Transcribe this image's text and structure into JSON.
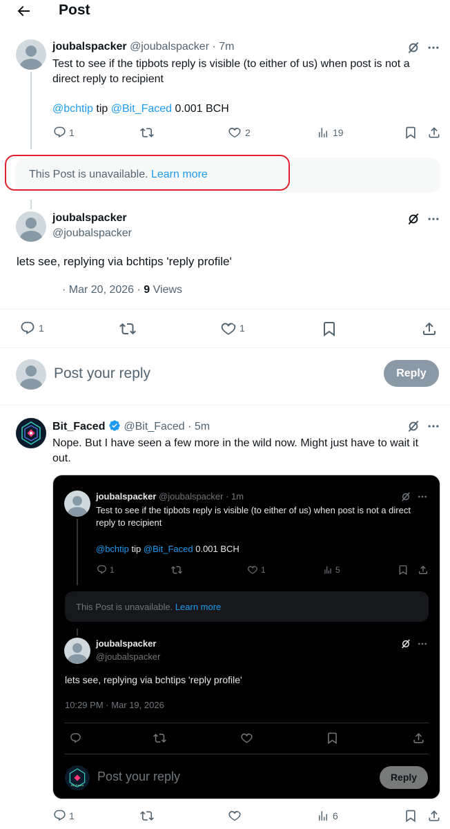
{
  "header": {
    "title": "Post"
  },
  "thread_post": {
    "name": "joubalspacker",
    "handle": "@joubalspacker",
    "time": "· 7m",
    "text": "Test to see if the tipbots reply is visible (to either of us) when post is not a direct reply to recipient",
    "mention1": "@bchtip",
    "tip_word": "tip",
    "mention2": "@Bit_Faced",
    "amount": "0.001 BCH",
    "replies": "1",
    "likes": "2",
    "views": "19"
  },
  "unavailable": {
    "text": "This Post is unavailable.",
    "link": "Learn more"
  },
  "main_post": {
    "name": "joubalspacker",
    "handle": "@joubalspacker",
    "text": "lets see, replying via bchtips 'reply profile'",
    "date": "· Mar 20, 2026 ·",
    "views_count": "9",
    "views_label": "Views",
    "replies": "1",
    "likes": "1"
  },
  "reply_box": {
    "placeholder": "Post your reply",
    "button": "Reply"
  },
  "bitfaced_post": {
    "name": "Bit_Faced",
    "handle": "@Bit_Faced",
    "time": "· 5m",
    "text": "Nope. But I have seen a few more in the wild now. Might just have to wait it out.",
    "replies": "1",
    "views": "6"
  },
  "embed": {
    "post": {
      "name": "joubalspacker",
      "handle": "@joubalspacker",
      "time": "· 1m",
      "text": "Test to see if the tipbots reply is visible (to either of us) when post is not a direct reply to recipient",
      "mention1": "@bchtip",
      "tip_word": "tip",
      "mention2": "@Bit_Faced",
      "amount": "0.001 BCH",
      "replies": "1",
      "likes": "1",
      "views": "5"
    },
    "unavailable": {
      "text": "This Post is unavailable.",
      "link": "Learn more"
    },
    "main": {
      "name": "joubalspacker",
      "handle": "@joubalspacker",
      "text": "lets see, replying via bchtips 'reply profile'",
      "date": "10:29 PM · Mar 19, 2026"
    },
    "reply_box": {
      "placeholder": "Post your reply",
      "button": "Reply"
    },
    "avatar_text": "Bit_Faced"
  },
  "colors": {
    "accent": "#1d9bf0",
    "annotation": "#e0202a",
    "embed_bg": "#000000"
  }
}
